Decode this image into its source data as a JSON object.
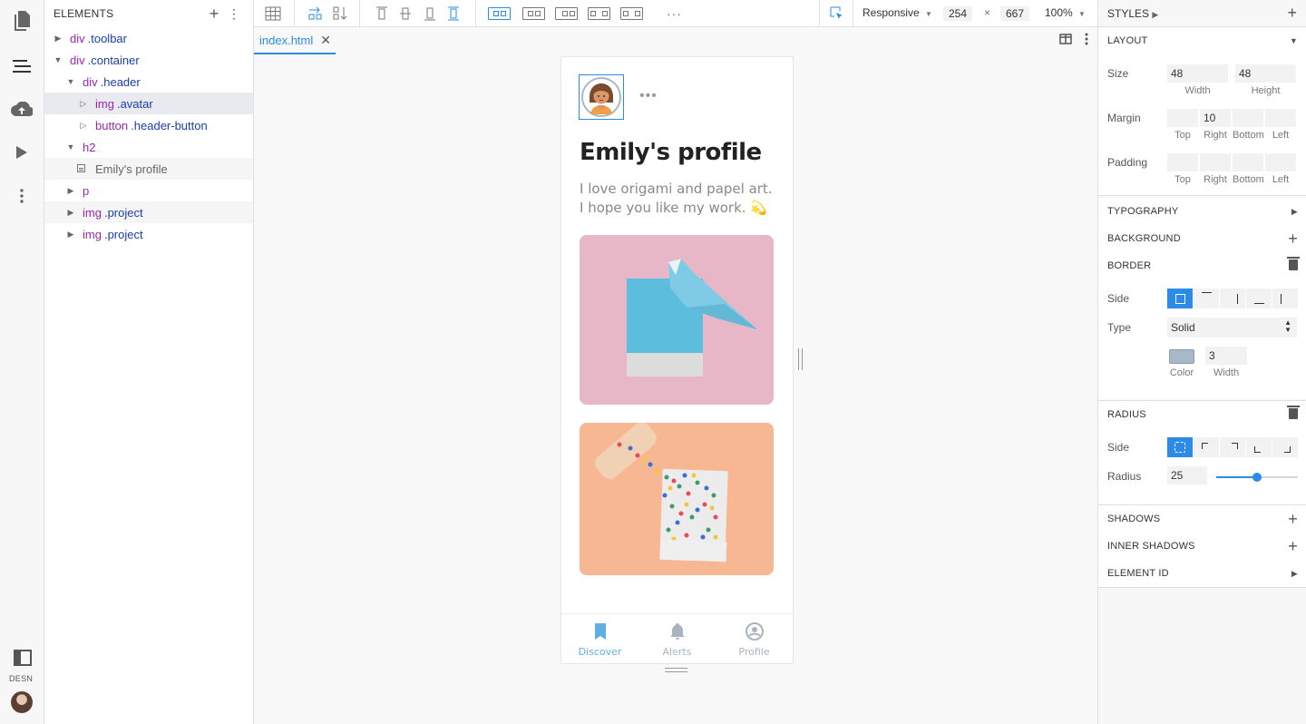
{
  "rail": {
    "items": [
      "pages-icon",
      "layers-icon",
      "cloud-upload-icon",
      "play-icon",
      "more-vert-icon"
    ],
    "desn_label": "DESN"
  },
  "elements": {
    "title": "ELEMENTS",
    "tree": [
      {
        "tag": "div",
        "cls": ".toolbar",
        "indent": 0,
        "expanded": false
      },
      {
        "tag": "div",
        "cls": ".container",
        "indent": 0,
        "expanded": true
      },
      {
        "tag": "div",
        "cls": ".header",
        "indent": 1,
        "expanded": true
      },
      {
        "tag": "img",
        "cls": ".avatar",
        "indent": 2,
        "expanded": false,
        "selected": true
      },
      {
        "tag": "button",
        "cls": ".header-button",
        "indent": 2,
        "expanded": false
      },
      {
        "tag": "h2",
        "cls": "",
        "indent": 1,
        "expanded": true
      },
      {
        "text": "Emily's profile",
        "indent": 2
      },
      {
        "tag": "p",
        "cls": "",
        "indent": 1,
        "expanded": false
      },
      {
        "tag": "img",
        "cls": ".project",
        "indent": 1,
        "expanded": false
      },
      {
        "tag": "img",
        "cls": ".project",
        "indent": 1,
        "expanded": false
      }
    ]
  },
  "toolbar": {
    "device": "Responsive",
    "width": "254",
    "height": "667",
    "zoom": "100%",
    "times": "×",
    "more": "···"
  },
  "canvas": {
    "tab_label": "index.html",
    "tab_close": "✕"
  },
  "phone": {
    "title": "Emily's profile",
    "bio": "I love origami and papel art. I hope you like my work. 💫",
    "nav": [
      {
        "label": "Discover",
        "active": true
      },
      {
        "label": "Alerts",
        "active": false
      },
      {
        "label": "Profile",
        "active": false
      }
    ]
  },
  "styles": {
    "title": "STYLES",
    "layout": {
      "title": "LAYOUT",
      "size_label": "Size",
      "width": "48",
      "height": "48",
      "width_label": "Width",
      "height_label": "Height",
      "margin_label": "Margin",
      "margin": {
        "top": "",
        "right": "10",
        "bottom": "",
        "left": ""
      },
      "padding_label": "Padding",
      "padding": {
        "top": "",
        "right": "",
        "bottom": "",
        "left": ""
      },
      "sides": [
        "Top",
        "Right",
        "Bottom",
        "Left"
      ]
    },
    "typography": "TYPOGRAPHY",
    "background": "BACKGROUND",
    "border": {
      "title": "BORDER",
      "side_label": "Side",
      "type_label": "Type",
      "type_value": "Solid",
      "color_label": "Color",
      "width_label": "Width",
      "width_value": "3",
      "color": "#a7b8c9"
    },
    "radius": {
      "title": "RADIUS",
      "side_label": "Side",
      "radius_label": "Radius",
      "radius_value": "25",
      "slider_fraction": 0.5
    },
    "shadows": "SHADOWS",
    "inner_shadows": "INNER SHADOWS",
    "element_id": "ELEMENT ID"
  },
  "colors": {
    "accent": "#2a8ce8",
    "tag": "#9c27b0",
    "cls": "#1a3fa8"
  }
}
